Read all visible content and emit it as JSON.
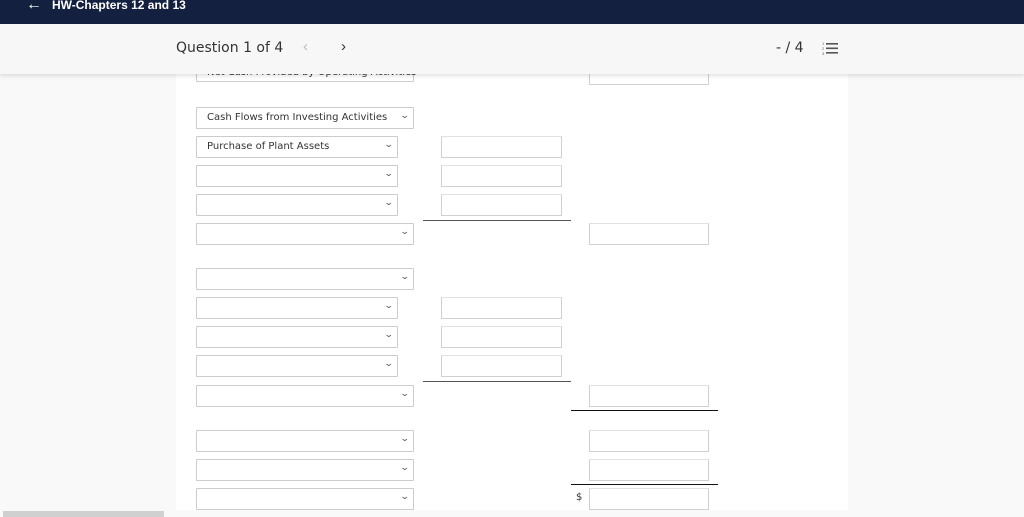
{
  "topbar": {
    "back_icon": "arrow-left-icon",
    "back_glyph": "←",
    "title": "HW-Chapters 12 and 13",
    "background": "#142040"
  },
  "question_header": {
    "label": "Question 1 of 4",
    "prev_glyph": "‹",
    "next_glyph": "›",
    "score": "- / 4",
    "list_icon": "numbered-list-icon"
  },
  "form": {
    "partial_top_select": "Net Cash Provided by Operating Activities",
    "chevron": "⌄",
    "dollar_sign": "$",
    "selects": [
      {
        "value": "Cash Flows from Investing Activities"
      },
      {
        "value": "Purchase of Plant Assets"
      },
      {
        "value": ""
      },
      {
        "value": ""
      },
      {
        "value": ""
      },
      {
        "value": ""
      },
      {
        "value": ""
      },
      {
        "value": ""
      },
      {
        "value": ""
      },
      {
        "value": ""
      },
      {
        "value": ""
      },
      {
        "value": ""
      },
      {
        "value": ""
      }
    ],
    "inputs": [
      {
        "value": ""
      },
      {
        "value": ""
      },
      {
        "value": ""
      },
      {
        "value": ""
      },
      {
        "value": ""
      },
      {
        "value": ""
      },
      {
        "value": ""
      },
      {
        "value": ""
      },
      {
        "value": ""
      },
      {
        "value": ""
      },
      {
        "value": ""
      },
      {
        "value": ""
      }
    ]
  }
}
